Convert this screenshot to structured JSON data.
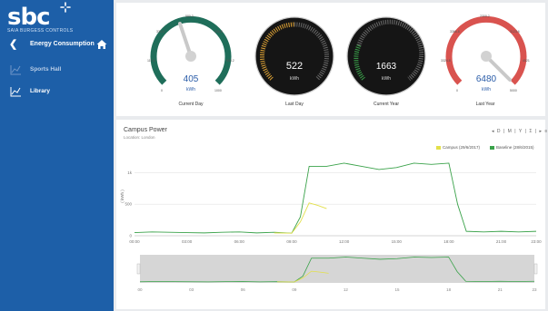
{
  "brand": {
    "logo_text": "sbc",
    "company": "SAIA BURGESS CONTROLS"
  },
  "sidebar": {
    "title": "Energy Consumption",
    "items": [
      {
        "label": "Sports Hall",
        "icon": "line-chart-icon",
        "active": false
      },
      {
        "label": "Library",
        "icon": "line-chart-icon",
        "active": true
      }
    ]
  },
  "gauges": [
    {
      "value": "405",
      "unit": "kWh",
      "label": "Current Day",
      "style": "light",
      "color": "#1f6e5a",
      "ticks": [
        "0",
        "117.4",
        "333.0",
        "580.3",
        "806.8",
        "933.2",
        "1000"
      ]
    },
    {
      "value": "522",
      "unit": "kWh",
      "label": "Last Day",
      "style": "dark"
    },
    {
      "value": "1663",
      "unit": "kWh",
      "label": "Current Year",
      "style": "dark"
    },
    {
      "value": "6480",
      "unit": "kWh",
      "label": "Last Year",
      "style": "light",
      "color": "#d9534f",
      "ticks": [
        "0",
        "3324.8",
        "3366.8",
        "2300.2",
        "3123.6",
        "4521",
        "5000"
      ]
    }
  ],
  "chart_panel": {
    "title": "Campus Power",
    "subtitle": "Location: London",
    "controls": [
      "◂",
      "D",
      "|",
      "M",
      "|",
      "Y",
      "|",
      "Σ",
      "|",
      "▸",
      "≡"
    ],
    "legend": [
      {
        "name": "Campus (29/6/2017)",
        "color": "#e3e04a"
      },
      {
        "name": "Baseline (28/6/2015)",
        "color": "#3aa24a"
      }
    ]
  },
  "chart_data": {
    "type": "line",
    "ylabel": "( kWh )",
    "yticks": [
      "0",
      "500",
      "1k"
    ],
    "ylim": [
      0,
      1250
    ],
    "x_ticks": [
      "00:00",
      "03:00",
      "06:00",
      "09:00",
      "12:00",
      "15:00",
      "18:00",
      "21:00",
      "23:00"
    ],
    "x": [
      0,
      1,
      2,
      3,
      4,
      5,
      6,
      7,
      8,
      9,
      9.5,
      10,
      11,
      12,
      13,
      14,
      15,
      16,
      17,
      18,
      18.5,
      19,
      20,
      21,
      22,
      23
    ],
    "series": [
      {
        "name": "Baseline (28/6/2015)",
        "color": "#3aa24a",
        "values": [
          50,
          60,
          55,
          50,
          45,
          55,
          60,
          45,
          55,
          40,
          300,
          1100,
          1100,
          1150,
          1100,
          1050,
          1080,
          1150,
          1130,
          1150,
          500,
          70,
          60,
          70,
          60,
          70
        ]
      },
      {
        "name": "Campus (29/6/2017)",
        "color": "#e3e04a",
        "x": [
          8,
          9,
          9.5,
          10,
          10.5,
          11
        ],
        "values": [
          45,
          40,
          220,
          520,
          480,
          430
        ]
      }
    ],
    "navigator": {
      "x_ticks": [
        "00",
        "03",
        "06",
        "09",
        "12",
        "15",
        "18",
        "21",
        "23"
      ]
    }
  }
}
